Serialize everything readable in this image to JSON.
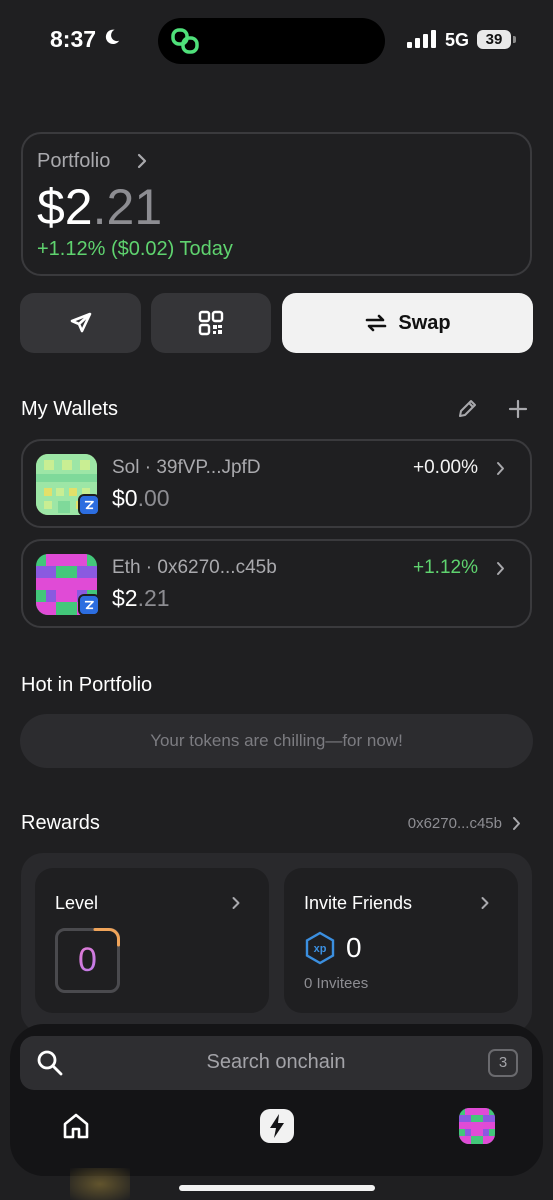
{
  "status_bar": {
    "time": "8:37",
    "network": "5G",
    "battery": "39"
  },
  "portfolio": {
    "label": "Portfolio",
    "balance_whole": "$2",
    "balance_decimal": ".21",
    "change": "+1.12% ($0.02) Today"
  },
  "actions": {
    "send_icon": "send-icon",
    "qr_icon": "qr-code-icon",
    "swap_label": "Swap"
  },
  "wallets": {
    "title": "My Wallets",
    "items": [
      {
        "name": "Sol · 39fVP...JpfD",
        "balance_whole": "$0",
        "balance_decimal": ".00",
        "change": "+0.00%",
        "change_color": "#f2f2f2"
      },
      {
        "name": "Eth · 0x6270...c45b",
        "balance_whole": "$2",
        "balance_decimal": ".21",
        "change": "+1.12%",
        "change_color": "#5fd36f"
      }
    ]
  },
  "hot": {
    "title": "Hot in Portfolio",
    "empty_text": "Your tokens are chilling—for now!"
  },
  "rewards": {
    "title": "Rewards",
    "address": "0x6270...c45b",
    "level": {
      "title": "Level",
      "value": "0"
    },
    "invite": {
      "title": "Invite Friends",
      "xp": "0",
      "invitees": "0 Invitees"
    }
  },
  "search": {
    "placeholder": "Search onchain",
    "shortcut": "3"
  },
  "colors": {
    "accent_green": "#5fd36f",
    "background": "#1f1f21",
    "card_border": "#3a3a3d"
  }
}
